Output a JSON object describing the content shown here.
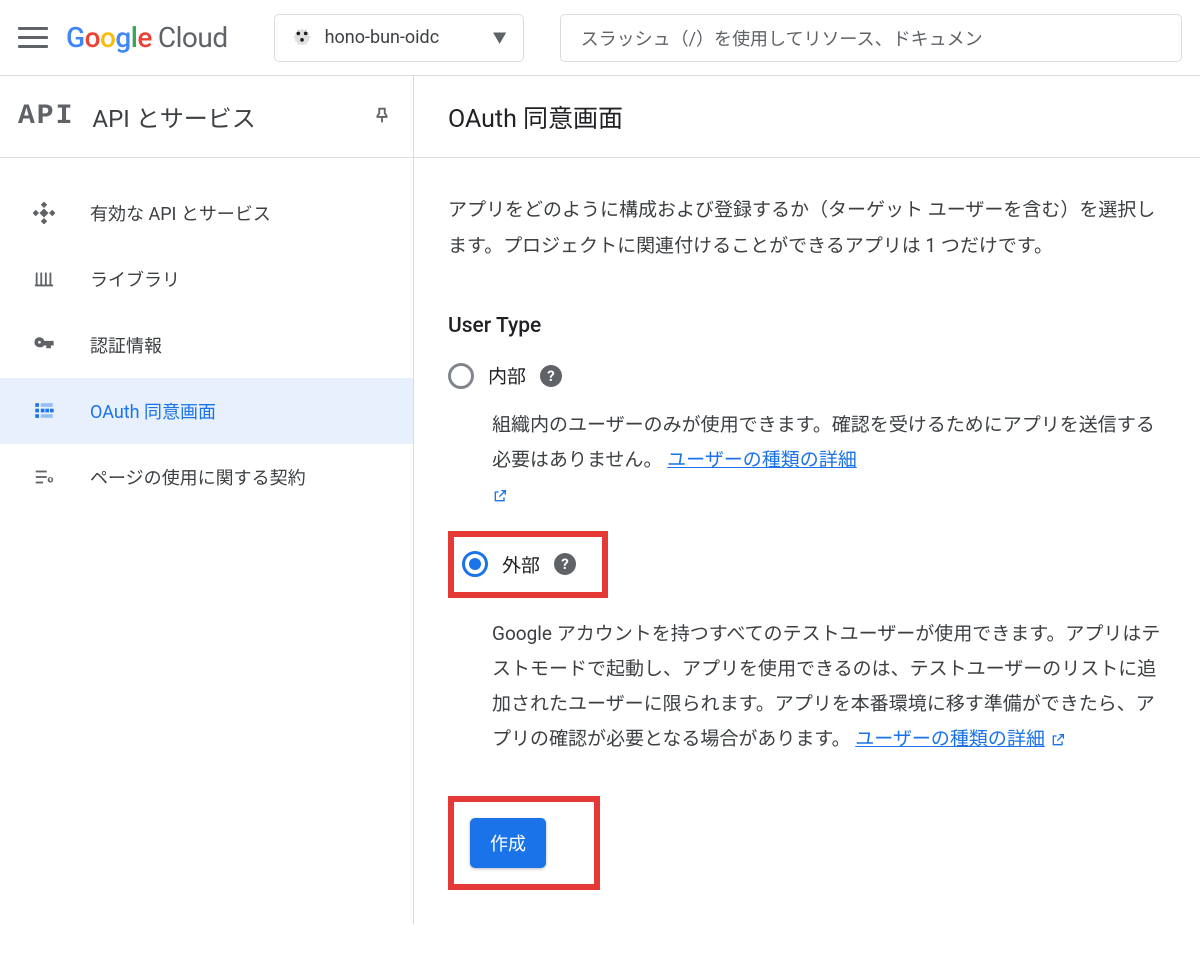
{
  "header": {
    "brand_cloud": "Cloud",
    "project_name": "hono-bun-oidc",
    "search_placeholder": "スラッシュ（/）を使用してリソース、ドキュメン"
  },
  "sidebar": {
    "api_logo": "API",
    "title": "API とサービス",
    "items": [
      {
        "label": "有効な API とサービス",
        "icon": "api-diamond-icon",
        "selected": false
      },
      {
        "label": "ライブラリ",
        "icon": "library-icon",
        "selected": false
      },
      {
        "label": "認証情報",
        "icon": "key-icon",
        "selected": false
      },
      {
        "label": "OAuth 同意画面",
        "icon": "consent-icon",
        "selected": true
      },
      {
        "label": "ページの使用に関する契約",
        "icon": "agreement-icon",
        "selected": false
      }
    ]
  },
  "main": {
    "page_title": "OAuth 同意画面",
    "description": "アプリをどのように構成および登録するか（ターゲット ユーザーを含む）を選択します。プロジェクトに関連付けることができるアプリは 1 つだけです。",
    "user_type_heading": "User Type",
    "options": {
      "internal": {
        "label": "内部",
        "desc": "組織内のユーザーのみが使用できます。確認を受けるためにアプリを送信する必要はありません。 ",
        "link": "ユーザーの種類の詳細"
      },
      "external": {
        "label": "外部",
        "desc": "Google アカウントを持つすべてのテストユーザーが使用できます。アプリはテストモードで起動し、アプリを使用できるのは、テストユーザーのリストに追加されたユーザーに限られます。アプリを本番環境に移す準備ができたら、アプリの確認が必要となる場合があります。 ",
        "link": "ユーザーの種類の詳細"
      }
    },
    "create_button": "作成"
  }
}
